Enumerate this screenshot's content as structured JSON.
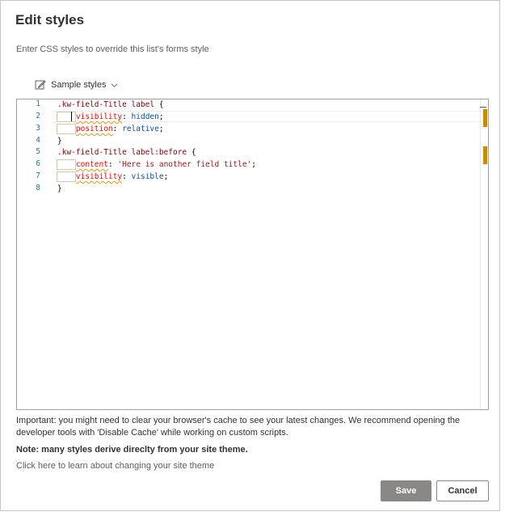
{
  "dialog": {
    "title": "Edit styles",
    "subtitle": "Enter CSS styles to override this list's forms style",
    "sample_label": "Sample styles"
  },
  "editor": {
    "line_numbers": [
      "1",
      "2",
      "3",
      "4",
      "5",
      "6",
      "7",
      "8"
    ],
    "lines": [
      ".kw-field-Title label {",
      "    visibility: hidden;",
      "    position: relative;",
      "}",
      ".kw-field-Title label:before {",
      "    content: 'Here is another field title';",
      "    visibility: visible;",
      "}"
    ]
  },
  "notes": {
    "important": "Important: you might need to clear your browser's cache to see your latest changes. We recommend opening the developer tools with 'Disable Cache' while working on custom scripts.",
    "theme_note": "Note: many styles derive direclty from your site theme.",
    "theme_link": "Click here to learn about changing your site theme"
  },
  "buttons": {
    "save": "Save",
    "cancel": "Cancel"
  },
  "icons": {
    "sample": "edit-icon",
    "dropdown": "chevron-down-icon"
  },
  "colors": {
    "save_bg": "#8a8886",
    "selector": "#800000",
    "property": "#ff0000",
    "value": "#0451a5",
    "string": "#a31515",
    "line_number": "#237893",
    "overview_mark": "#c98a00"
  }
}
